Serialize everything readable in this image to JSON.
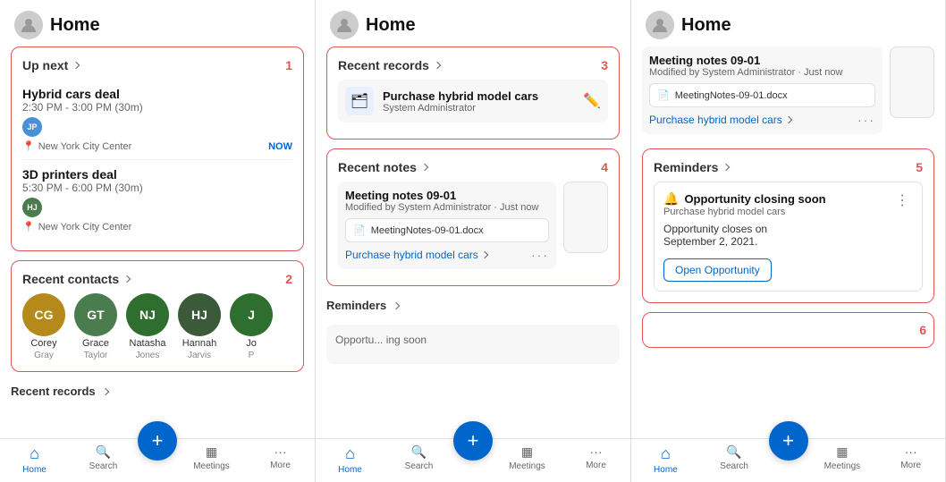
{
  "panels": [
    {
      "id": "panel1",
      "header": {
        "title": "Home"
      },
      "sections": [
        {
          "id": "up-next",
          "label": "Up next",
          "number": "1",
          "events": [
            {
              "title": "Hybrid cars deal",
              "time": "2:30 PM - 3:00 PM (30m)",
              "user_initials": "JP",
              "user_color": "#4a90d9",
              "location": "New York City Center",
              "badge": "NOW"
            },
            {
              "title": "3D printers deal",
              "time": "5:30 PM - 6:00 PM (30m)",
              "user_initials": "HJ",
              "user_color": "#4a7c4e",
              "location": "New York City Center",
              "badge": ""
            }
          ]
        },
        {
          "id": "recent-contacts",
          "label": "Recent contacts",
          "number": "2",
          "contacts": [
            {
              "initials": "CG",
              "first": "Corey",
              "last": "Gray",
              "color": "#b5891a"
            },
            {
              "initials": "GT",
              "first": "Grace",
              "last": "Taylor",
              "color": "#4a7c4e"
            },
            {
              "initials": "NJ",
              "first": "Natasha",
              "last": "Jones",
              "color": "#2e6e2e"
            },
            {
              "initials": "HJ",
              "first": "Hannah",
              "last": "Jarvis",
              "color": "#3a5a3a"
            },
            {
              "initials": "J",
              "first": "Jo",
              "last": "P",
              "color": "#2e6e2e"
            }
          ]
        },
        {
          "id": "recent-records",
          "label": "Recent records",
          "number": ""
        }
      ],
      "nav": {
        "items": [
          {
            "label": "Home",
            "icon": "⌂",
            "active": true
          },
          {
            "label": "Search",
            "icon": "🔍",
            "active": false
          },
          {
            "label": "Meetings",
            "icon": "▦",
            "active": false
          },
          {
            "label": "More",
            "icon": "···",
            "active": false
          }
        ],
        "fab_label": "+"
      }
    },
    {
      "id": "panel2",
      "header": {
        "title": "Home"
      },
      "sections": [
        {
          "id": "recent-records",
          "label": "Recent records",
          "number": "3",
          "record": {
            "title": "Purchase hybrid model cars",
            "sub": "System Administrator",
            "icon": "🗂"
          }
        },
        {
          "id": "recent-notes",
          "label": "Recent notes",
          "number": "4",
          "note": {
            "title": "Meeting notes 09-01",
            "modified": "Modified by System Administrator · Just now",
            "file": "MeetingNotes-09-01.docx",
            "link": "Purchase hybrid model cars"
          }
        },
        {
          "id": "reminders",
          "label": "Reminders",
          "number": ""
        }
      ],
      "nav": {
        "items": [
          {
            "label": "Home",
            "icon": "⌂",
            "active": true
          },
          {
            "label": "Search",
            "icon": "🔍",
            "active": false
          },
          {
            "label": "Meetings",
            "icon": "▦",
            "active": false
          },
          {
            "label": "More",
            "icon": "···",
            "active": false
          }
        ],
        "fab_label": "+"
      }
    },
    {
      "id": "panel3",
      "header": {
        "title": "Home"
      },
      "sections": [
        {
          "id": "recent-notes-partial",
          "label": "",
          "note": {
            "title": "Meeting notes 09-01",
            "modified": "Modified by System Administrator · Just now",
            "file": "MeetingNotes-09-01.docx",
            "link": "Purchase hybrid model cars"
          }
        },
        {
          "id": "reminders",
          "label": "Reminders",
          "number": "5",
          "reminder": {
            "title": "Opportunity closing soon",
            "sub": "Purchase hybrid model cars",
            "body": "Opportunity closes on\nSeptember 2, 2021.",
            "button": "Open Opportunity"
          }
        },
        {
          "id": "section6",
          "number": "6"
        }
      ],
      "nav": {
        "items": [
          {
            "label": "Home",
            "icon": "⌂",
            "active": true
          },
          {
            "label": "Search",
            "icon": "🔍",
            "active": false
          },
          {
            "label": "Meetings",
            "icon": "▦",
            "active": false
          },
          {
            "label": "More",
            "icon": "···",
            "active": false
          }
        ],
        "fab_label": "+"
      }
    }
  ]
}
